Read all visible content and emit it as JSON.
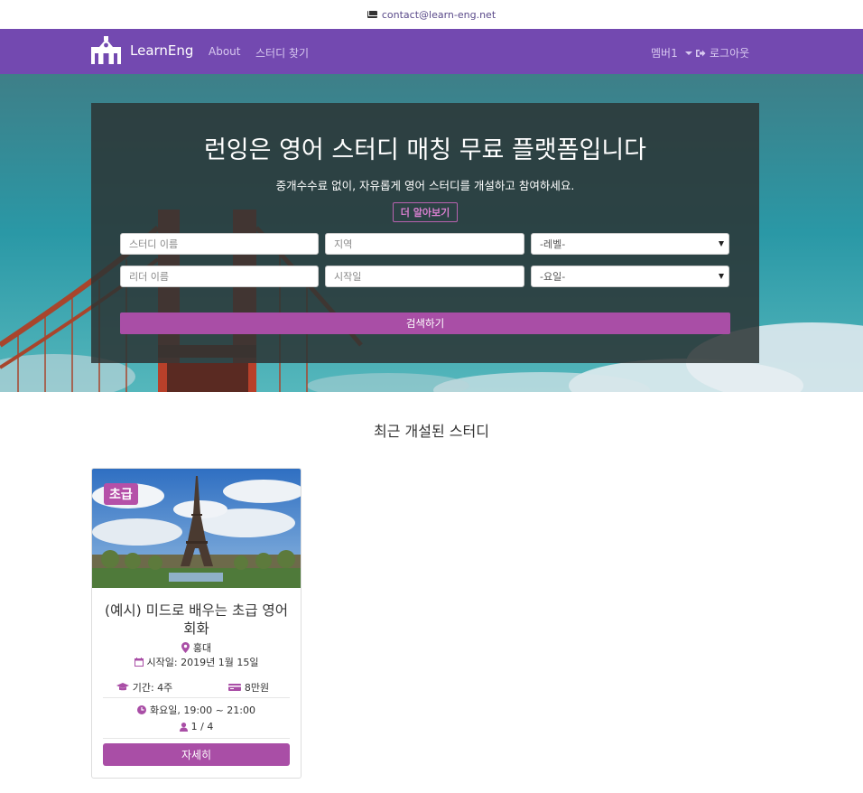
{
  "topbar": {
    "email": "contact@learn-eng.net"
  },
  "navbar": {
    "brand": "LearnEng",
    "links": [
      "About",
      "스터디 찾기"
    ],
    "member": "멤버1",
    "logout": "로그아웃"
  },
  "hero": {
    "title": "런잉은 영어 스터디 매칭 무료 플랫폼입니다",
    "subtitle": "중개수수료 없이, 자유롭게 영어 스터디를 개설하고 참여하세요.",
    "more_button": "더 알아보기",
    "fields": {
      "study_name_placeholder": "스터디 이름",
      "region_placeholder": "지역",
      "level_select": "-레벨-",
      "leader_placeholder": "리더 이름",
      "start_date_placeholder": "시작일",
      "day_select": "-요일-"
    },
    "search_button": "검색하기"
  },
  "recent": {
    "title": "최근 개설된 스터디",
    "cards": [
      {
        "level": "초급",
        "title": "(예시) 미드로 배우는 초급 영어회화",
        "location": "홍대",
        "start_date": "시작일: 2019년 1월 15일",
        "duration": "기간: 4주",
        "price": "8만원",
        "schedule": "화요일, 19:00 ~ 21:00",
        "members": "1 / 4",
        "detail_button": "자세히"
      }
    ]
  },
  "colors": {
    "brand_purple": "#7349b0",
    "accent": "#a94ea6"
  }
}
